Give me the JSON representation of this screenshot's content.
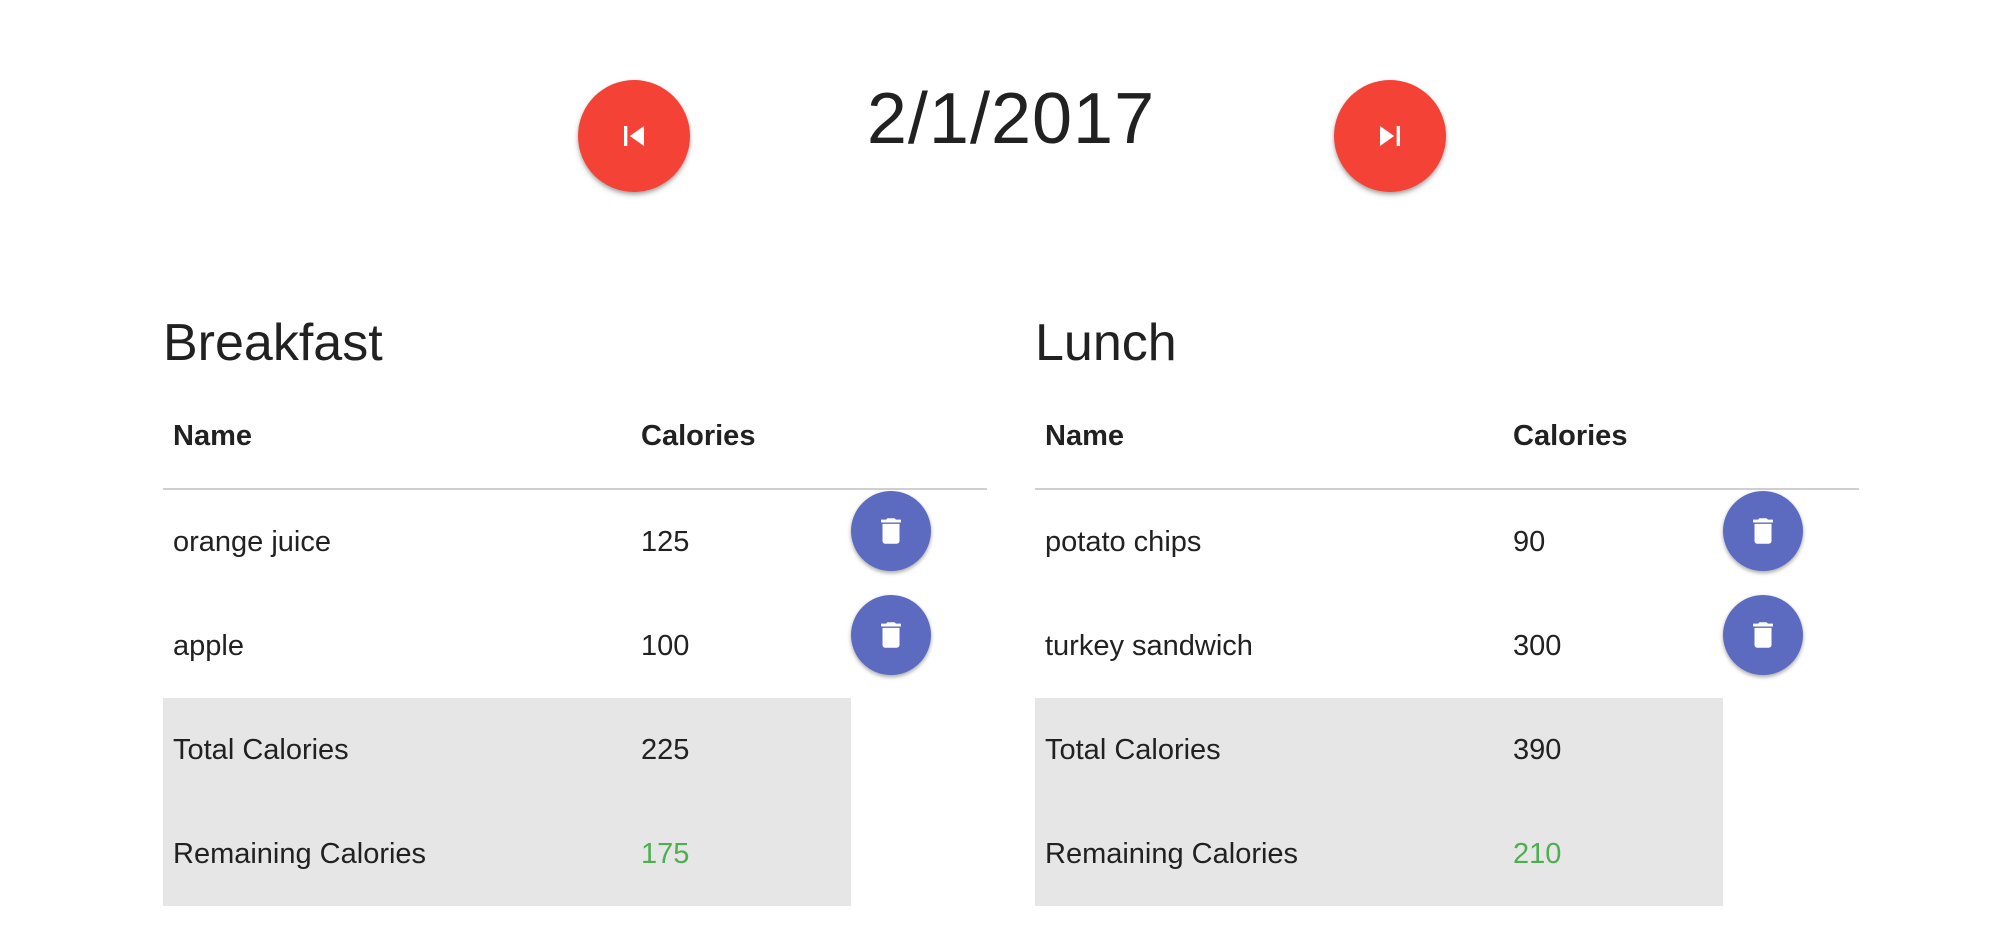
{
  "header": {
    "date": "2/1/2017",
    "prev_icon": "skip-previous-icon",
    "next_icon": "skip-next-icon"
  },
  "colors": {
    "fab": "#f44336",
    "delete": "#5c6bc0",
    "remaining": "#4caf50",
    "summary_bg": "#e6e6e6"
  },
  "breakfast": {
    "title": "Breakfast",
    "col_name": "Name",
    "col_calories": "Calories",
    "items": [
      {
        "name": "orange juice",
        "calories": "125"
      },
      {
        "name": "apple",
        "calories": "100"
      }
    ],
    "total_label": "Total Calories",
    "total_value": "225",
    "remaining_label": "Remaining Calories",
    "remaining_value": "175",
    "delete_icon": "trash-icon"
  },
  "lunch": {
    "title": "Lunch",
    "col_name": "Name",
    "col_calories": "Calories",
    "items": [
      {
        "name": "potato chips",
        "calories": "90"
      },
      {
        "name": "turkey sandwich",
        "calories": "300"
      }
    ],
    "total_label": "Total Calories",
    "total_value": "390",
    "remaining_label": "Remaining Calories",
    "remaining_value": "210",
    "delete_icon": "trash-icon"
  }
}
